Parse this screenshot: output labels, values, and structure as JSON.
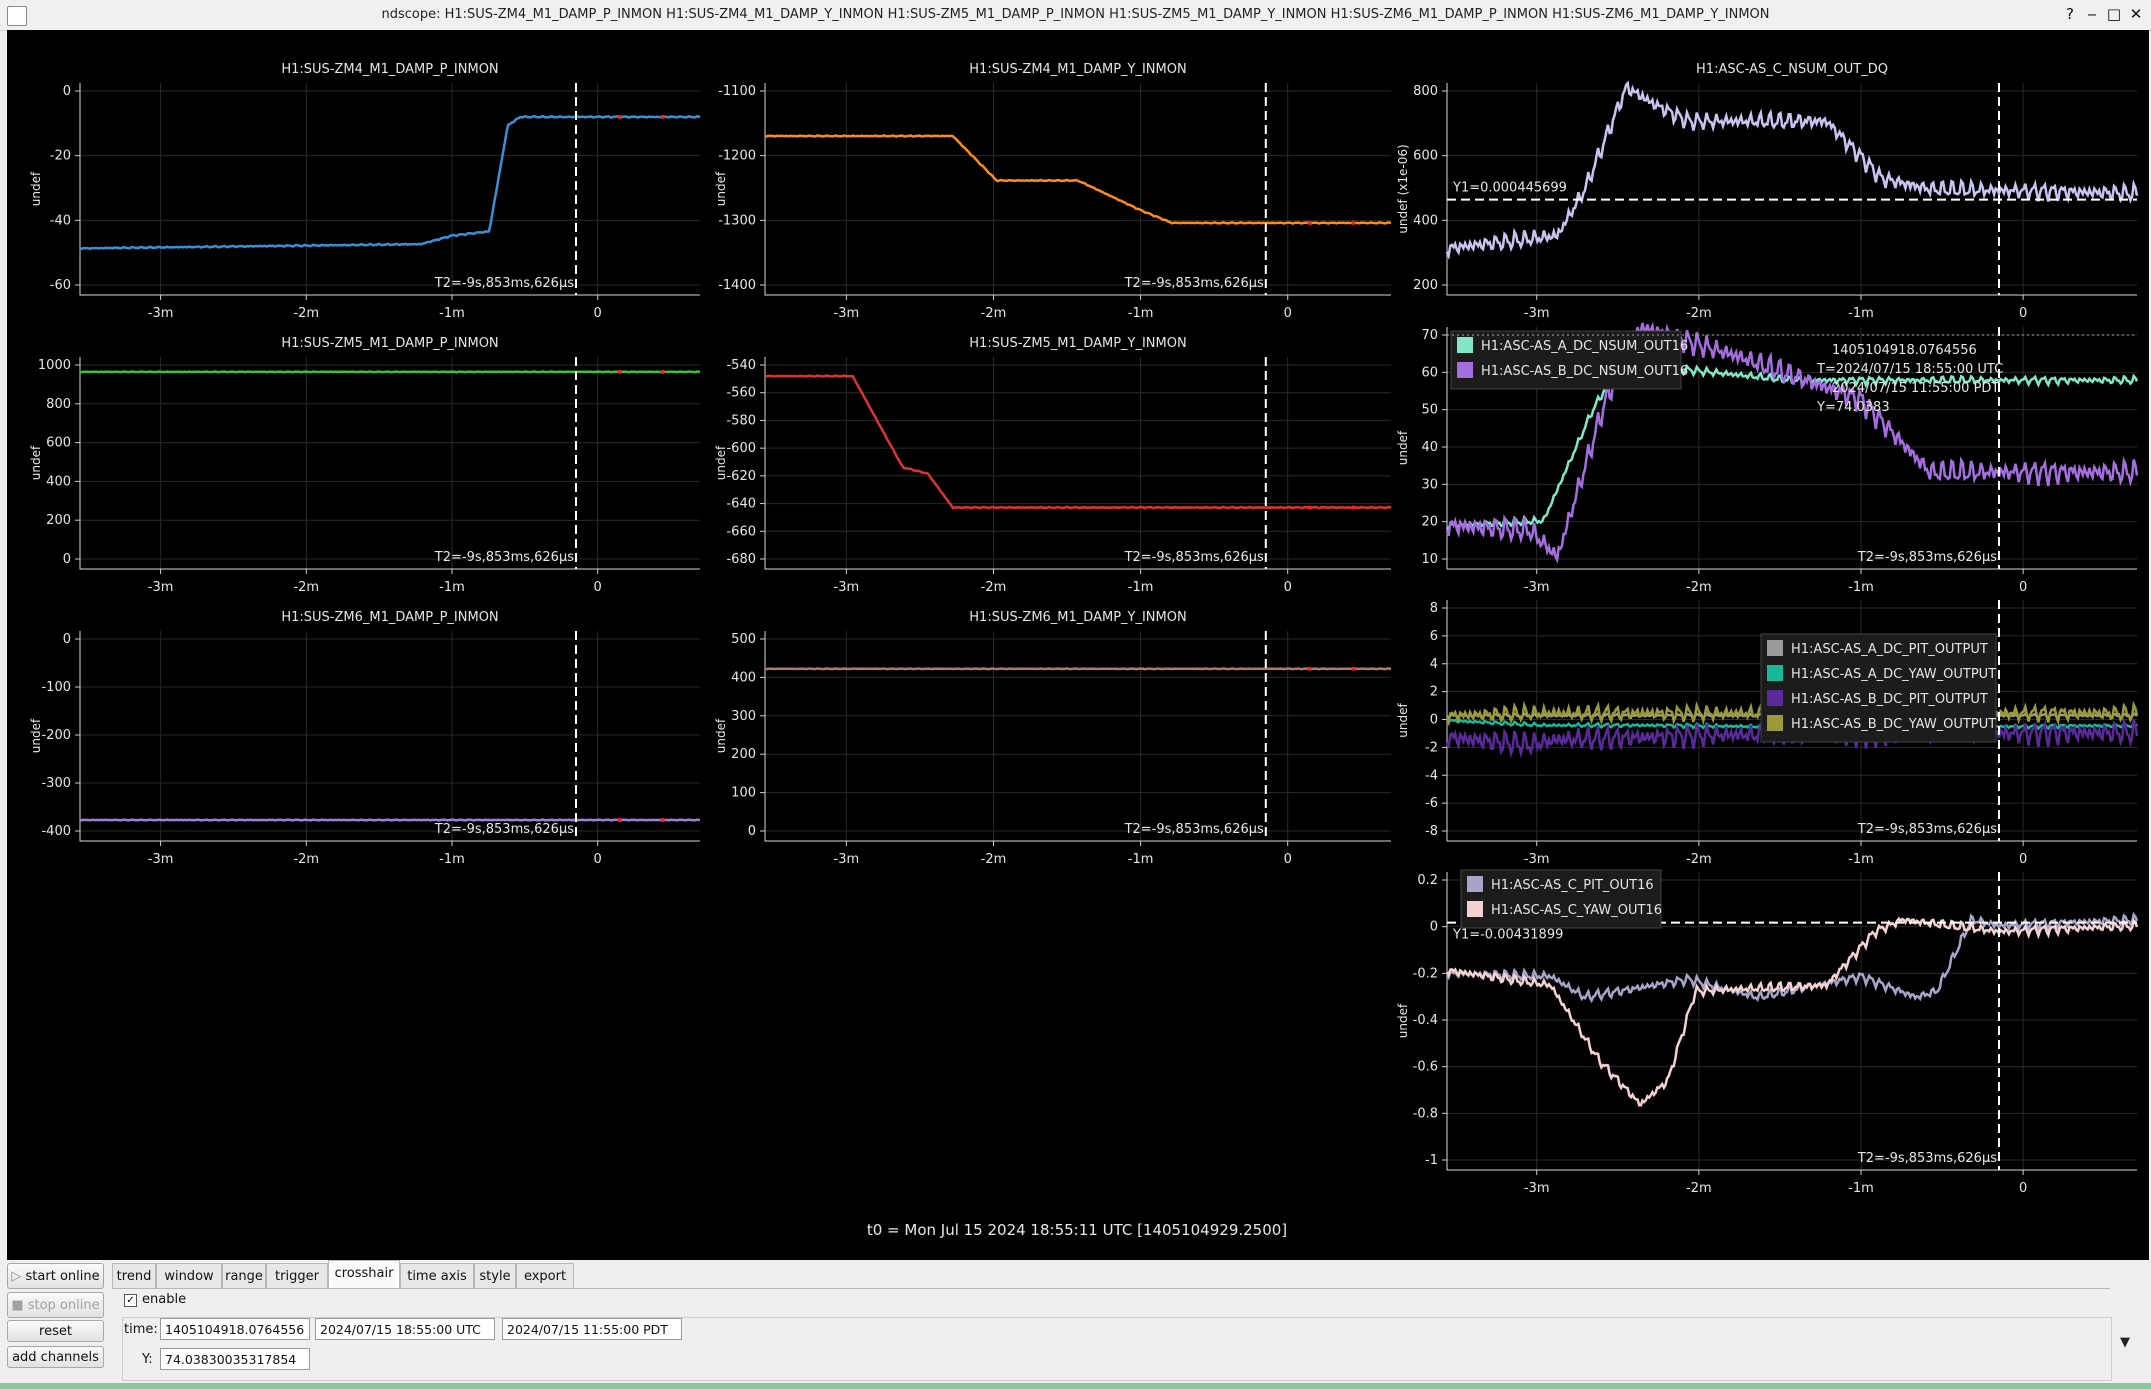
{
  "window": {
    "title": "ndscope: H1:SUS-ZM4_M1_DAMP_P_INMON H1:SUS-ZM4_M1_DAMP_Y_INMON H1:SUS-ZM5_M1_DAMP_P_INMON H1:SUS-ZM5_M1_DAMP_Y_INMON H1:SUS-ZM6_M1_DAMP_P_INMON H1:SUS-ZM6_M1_DAMP_Y_INMON",
    "buttons": {
      "minimize": "‒",
      "help": "?",
      "maximize": "□",
      "close": "✕"
    }
  },
  "t0_label": "t0 = Mon Jul 15 2024 18:55:11 UTC [1405104929.2500]",
  "colors": {
    "zm4_p": "#3b8fd4",
    "zm4_y": "#ff8c1a",
    "zm5_p": "#3fbf3f",
    "zm5_y": "#e03232",
    "zm6_p": "#a07fd8",
    "zm6_y": "#b07a6e",
    "nsum": "#c8c4f0",
    "a_nsum": "#7fe8c8",
    "b_nsum": "#a56ee0",
    "a_pit": "#9a9a9a",
    "a_yaw": "#1ab89a",
    "b_pit": "#5a2a9a",
    "b_yaw": "#9a9a3a",
    "c_pit": "#a8a4c8",
    "c_yaw": "#f4d2d2"
  },
  "plots": [
    {
      "id": "zm4_p",
      "title": "H1:SUS-ZM4_M1_DAMP_P_INMON",
      "ylabel": "undef",
      "yticks": [
        "0",
        "-20",
        "-40",
        "-60"
      ],
      "xticks": [
        "-3m",
        "-2m",
        "-1m",
        "0"
      ],
      "t2": "T2=-9s,853ms,626μs"
    },
    {
      "id": "zm4_y",
      "title": "H1:SUS-ZM4_M1_DAMP_Y_INMON",
      "ylabel": "undef",
      "yticks": [
        "-1100",
        "-1200",
        "-1300",
        "-1400"
      ],
      "xticks": [
        "-3m",
        "-2m",
        "-1m",
        "0"
      ],
      "t2": "T2=-9s,853ms,626μs"
    },
    {
      "id": "nsum",
      "title": "H1:ASC-AS_C_NSUM_OUT_DQ",
      "ylabel": "undef (x1e-06)",
      "yticks": [
        "800",
        "600",
        "400",
        "200"
      ],
      "xticks": [
        "-3m",
        "-2m",
        "-1m",
        "0"
      ],
      "y1": "Y1=0.000445699"
    },
    {
      "id": "zm5_p",
      "title": "H1:SUS-ZM5_M1_DAMP_P_INMON",
      "ylabel": "undef",
      "yticks": [
        "1000",
        "800",
        "600",
        "400",
        "200",
        "0"
      ],
      "xticks": [
        "-3m",
        "-2m",
        "-1m",
        "0"
      ],
      "t2": "T2=-9s,853ms,626μs"
    },
    {
      "id": "zm5_y",
      "title": "H1:SUS-ZM5_M1_DAMP_Y_INMON",
      "ylabel": "undef",
      "yticks": [
        "-540",
        "-560",
        "-580",
        "-600",
        "-620",
        "-640",
        "-660",
        "-680"
      ],
      "xticks": [
        "-3m",
        "-2m",
        "-1m",
        "0"
      ],
      "t2": "T2=-9s,853ms,626μs"
    },
    {
      "id": "dcnsum",
      "title": "",
      "ylabel": "undef",
      "yticks": [
        "70",
        "60",
        "50",
        "40",
        "30",
        "20",
        "10"
      ],
      "xticks": [
        "-3m",
        "-2m",
        "-1m",
        "0"
      ],
      "t2": "T2=-9s,853ms,626μs",
      "legend": [
        "H1:ASC-AS_A_DC_NSUM_OUT16",
        "H1:ASC-AS_B_DC_NSUM_OUT16"
      ],
      "cursor": [
        "1405104918.0764556",
        "T=2024/07/15 18:55:00 UTC",
        "2024/07/15 11:55:00 PDT",
        "Y=74.0383"
      ]
    },
    {
      "id": "zm6_p",
      "title": "H1:SUS-ZM6_M1_DAMP_P_INMON",
      "ylabel": "undef",
      "yticks": [
        "0",
        "-100",
        "-200",
        "-300",
        "-400"
      ],
      "xticks": [
        "-3m",
        "-2m",
        "-1m",
        "0"
      ],
      "t2": "T2=-9s,853ms,626μs"
    },
    {
      "id": "zm6_y",
      "title": "H1:SUS-ZM6_M1_DAMP_Y_INMON",
      "ylabel": "undef",
      "yticks": [
        "500",
        "400",
        "300",
        "200",
        "100",
        "0"
      ],
      "xticks": [
        "-3m",
        "-2m",
        "-1m",
        "0"
      ],
      "t2": "T2=-9s,853ms,626μs"
    },
    {
      "id": "dcout",
      "title": "",
      "ylabel": "undef",
      "yticks": [
        "8",
        "6",
        "4",
        "2",
        "0",
        "-2",
        "-4",
        "-6",
        "-8"
      ],
      "xticks": [
        "-3m",
        "-2m",
        "-1m",
        "0"
      ],
      "t2": "T2=-9s,853ms,626μs",
      "legend": [
        "H1:ASC-AS_A_DC_PIT_OUTPUT",
        "H1:ASC-AS_A_DC_YAW_OUTPUT",
        "H1:ASC-AS_B_DC_PIT_OUTPUT",
        "H1:ASC-AS_B_DC_YAW_OUTPUT"
      ]
    },
    {
      "id": "cout",
      "title": "",
      "ylabel": "undef",
      "yticks": [
        "0.2",
        "0",
        "-0.2",
        "-0.4",
        "-0.6",
        "-0.8",
        "-1"
      ],
      "xticks": [
        "-3m",
        "-2m",
        "-1m",
        "0"
      ],
      "t2": "T2=-9s,853ms,626μs",
      "y1": "Y1=-0.00431899",
      "legend": [
        "H1:ASC-AS_C_PIT_OUT16",
        "H1:ASC-AS_C_YAW_OUT16"
      ]
    }
  ],
  "side_buttons": {
    "start": "start online",
    "stop": "stop online",
    "reset": "reset",
    "add": "add channels"
  },
  "tabs": [
    "trend",
    "window",
    "range",
    "trigger",
    "crosshair",
    "time axis",
    "style",
    "export"
  ],
  "crosshair": {
    "enable_label": "enable",
    "enabled": true,
    "time_label": "time:",
    "gps": "1405104918.0764556",
    "utc": "2024/07/15 18:55:00 UTC",
    "local": "2024/07/15 11:55:00 PDT",
    "y_label": "Y:",
    "y": "74.03830035317854"
  }
}
